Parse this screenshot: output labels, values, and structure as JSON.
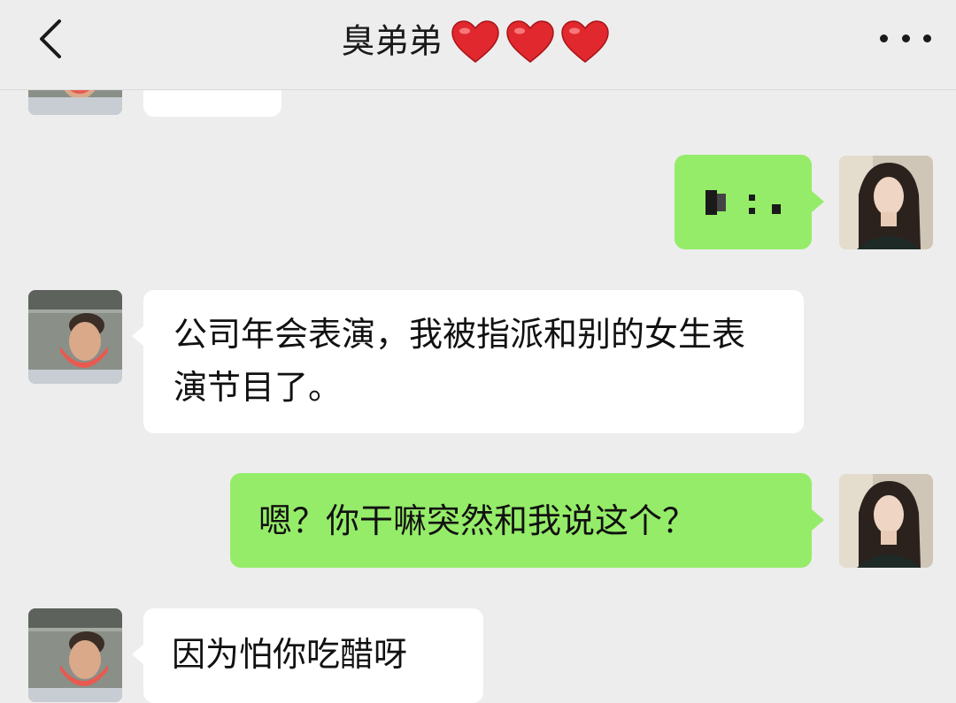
{
  "header": {
    "title": "臭弟弟",
    "hearts": 3,
    "back_icon": "chevron-left-icon",
    "more_icon": "more-dots-icon"
  },
  "colors": {
    "background": "#ededed",
    "incoming_bubble": "#ffffff",
    "outgoing_bubble": "#95ec69",
    "heart": "#e0282e"
  },
  "messages": [
    {
      "sender": "contact",
      "text": ""
    },
    {
      "sender": "self",
      "text": ""
    },
    {
      "sender": "contact",
      "text": "公司年会表演，我被指派和别的女生表演节目了。"
    },
    {
      "sender": "self",
      "text": "嗯？你干嘛突然和我说这个？"
    },
    {
      "sender": "contact",
      "text": "因为怕你吃醋呀"
    }
  ]
}
